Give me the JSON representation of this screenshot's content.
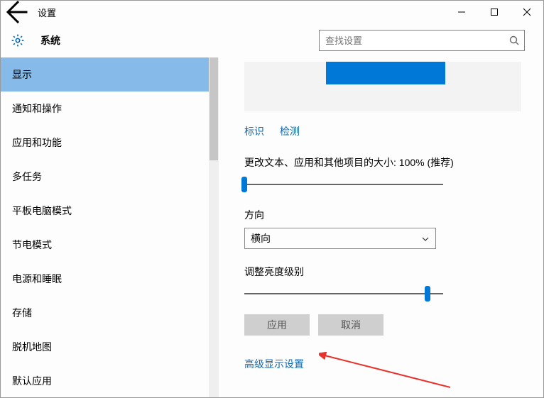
{
  "window": {
    "title": "设置"
  },
  "header": {
    "section": "系统",
    "search_placeholder": "查找设置"
  },
  "sidebar": {
    "items": [
      {
        "label": "显示",
        "active": true
      },
      {
        "label": "通知和操作"
      },
      {
        "label": "应用和功能"
      },
      {
        "label": "多任务"
      },
      {
        "label": "平板电脑模式"
      },
      {
        "label": "节电模式"
      },
      {
        "label": "电源和睡眠"
      },
      {
        "label": "存储"
      },
      {
        "label": "脱机地图"
      },
      {
        "label": "默认应用"
      }
    ]
  },
  "content": {
    "identify_link": "标识",
    "detect_link": "检测",
    "scale_label": "更改文本、应用和其他项目的大小: 100% (推荐)",
    "scale_value_percent": 0,
    "orientation_label": "方向",
    "orientation_value": "横向",
    "brightness_label": "调整亮度级别",
    "brightness_value_percent": 92,
    "apply_button": "应用",
    "cancel_button": "取消",
    "advanced_link": "高级显示设置"
  }
}
